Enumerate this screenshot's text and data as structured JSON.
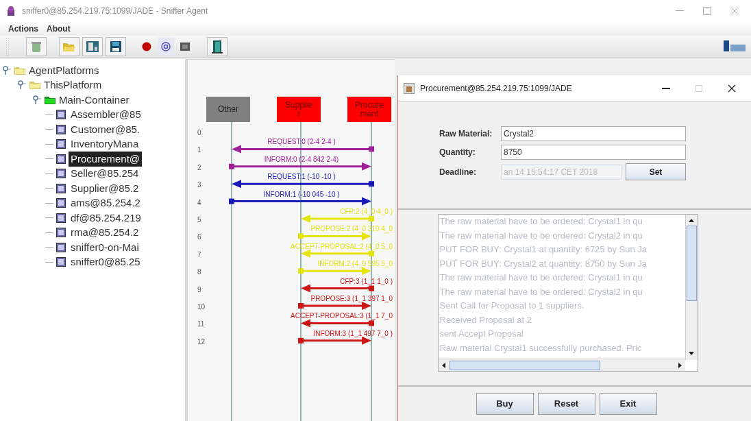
{
  "window": {
    "title": "sniffer0@85.254.219.75:1099/JADE - Sniffer Agent"
  },
  "menu": [
    "Actions",
    "About"
  ],
  "tree": [
    {
      "label": "AgentPlatforms",
      "kind": "platform",
      "expanded": true,
      "children": [
        {
          "label": "ThisPlatform",
          "kind": "platform",
          "expanded": true,
          "children": [
            {
              "label": "Main-Container",
              "kind": "container",
              "expanded": true,
              "children": [
                {
                  "label": "Assembler@85",
                  "kind": "agent",
                  "selected": false
                },
                {
                  "label": "Customer@85.",
                  "kind": "agent",
                  "selected": false
                },
                {
                  "label": "InventoryMana",
                  "kind": "agent",
                  "selected": false
                },
                {
                  "label": "Procurement@",
                  "kind": "agent",
                  "selected": true
                },
                {
                  "label": "Seller@85.254",
                  "kind": "agent",
                  "selected": false
                },
                {
                  "label": "Supplier@85.2",
                  "kind": "agent",
                  "selected": false
                },
                {
                  "label": "ams@85.254.2",
                  "kind": "agent",
                  "selected": false
                },
                {
                  "label": "df@85.254.219",
                  "kind": "agent",
                  "selected": false
                },
                {
                  "label": "rma@85.254.2",
                  "kind": "agent",
                  "selected": false
                },
                {
                  "label": "sniffer0-on-Mai",
                  "kind": "agent",
                  "selected": false
                },
                {
                  "label": "sniffer0@85.25",
                  "kind": "agent",
                  "selected": false
                }
              ]
            }
          ]
        }
      ]
    }
  ],
  "diagram": {
    "agents": [
      {
        "label": "Other",
        "color": "#808080"
      },
      {
        "label": "Supplier",
        "color": "#ff0000"
      },
      {
        "label": "Procurement",
        "color": "#ff0000"
      }
    ],
    "rows": [
      "0",
      "1",
      "2",
      "3",
      "4",
      "5",
      "6",
      "7",
      "8",
      "9",
      "10",
      "11",
      "12"
    ],
    "messages": [
      {
        "label": "REQUEST:0 (2-4 2-4 )",
        "kind": "long_left",
        "color": "#a0209a"
      },
      {
        "label": "INFORM:0 (2-4 842 2-4)",
        "kind": "long_right",
        "color": "#a0209a"
      },
      {
        "label": "REQUEST:1 (-10 -10 )",
        "kind": "long_left",
        "color": "#1a1ab8"
      },
      {
        "label": "INFORM:1 (-10 045 -10 )",
        "kind": "long_right",
        "color": "#1a1ab8"
      },
      {
        "label": "CFP:2 (4_0 4_0 )",
        "kind": "short_left",
        "color": "#e4e410"
      },
      {
        "label": "PROPOSE:2 (4_0 310 4_0",
        "kind": "short_right",
        "color": "#e4e410"
      },
      {
        "label": "ACCEPT-PROPOSAL:2 (4_0 5_0",
        "kind": "short_left",
        "color": "#e4e410"
      },
      {
        "label": "INFORM:2 (4_0 595 5_0",
        "kind": "short_right",
        "color": "#e4e410"
      },
      {
        "label": "CFP:3 (1_1 1_0 )",
        "kind": "short_left",
        "color": "#cc1515"
      },
      {
        "label": "PROPOSE:3 (1_1 397 1_0",
        "kind": "short_right",
        "color": "#cc1515"
      },
      {
        "label": "ACCEPT-PROPOSAL:3 (1_1 7_0",
        "kind": "short_left",
        "color": "#cc1515"
      },
      {
        "label": "INFORM:3 (1_1 497 7_0 )",
        "kind": "short_right",
        "color": "#cc1515"
      }
    ]
  },
  "dialog": {
    "title": "Procurement@85.254.219.75:1099/JADE",
    "fields": [
      {
        "label": "Raw Material:",
        "value": "Crystal2",
        "disabled": false
      },
      {
        "label": "Quantity:",
        "value": "8750",
        "disabled": false
      },
      {
        "label": "Deadline:",
        "value": "an 14 15:54:17 CET 2018",
        "disabled": true
      }
    ],
    "set_button": "Set",
    "log": {
      "disabled": true,
      "lines": [
        "The raw material have to be ordered: Crystal1 in qu",
        "The raw material have to be ordered: Crystal2 in qu",
        "PUT FOR BUY: Crystal1 at quantity: 6725 by Sun Ja",
        "PUT FOR BUY: Crystal2 at quantity: 8750 by Sun Ja",
        "The raw material have to be ordered: Crystal1 in qu",
        "The raw material have to be ordered: Crystal2 in qu",
        "Sent Call for Proposal to 1 suppliers.",
        "Received Proposal at 2",
        "sent Accept Proposal",
        "Raw material Crystal1 successfully purchased. Pric"
      ]
    },
    "buttons": [
      "Buy",
      "Reset",
      "Exit"
    ]
  }
}
